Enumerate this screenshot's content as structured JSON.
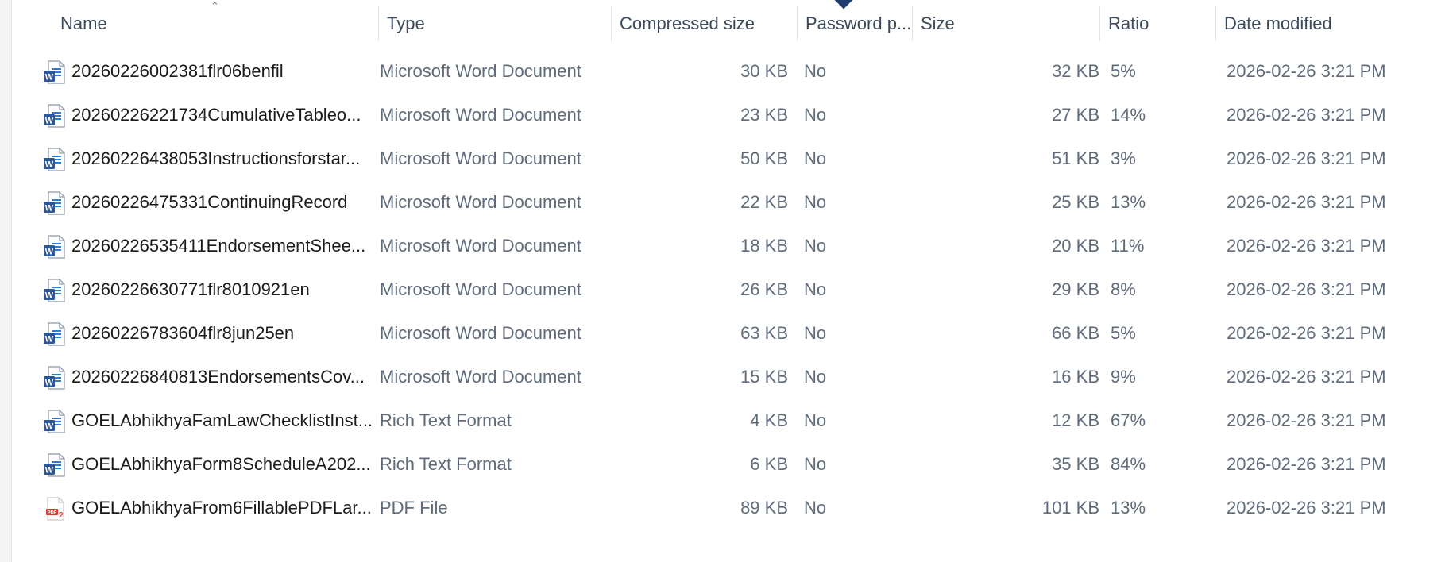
{
  "columns": {
    "name": "Name",
    "type": "Type",
    "compressed_size": "Compressed size",
    "password": "Password p...",
    "size": "Size",
    "ratio": "Ratio",
    "date_modified": "Date modified"
  },
  "icons": {
    "word": "word-document-icon",
    "pdf": "pdf-document-icon",
    "sort": "sort-caret-icon"
  },
  "colors": {
    "word_blue": "#2b579a",
    "pdf_red": "#d9382d",
    "header_text": "#3d4a5c",
    "cell_text": "#5f6b7a"
  },
  "files": [
    {
      "name": "20260226002381flr06benfil",
      "type": "Microsoft Word Document",
      "compressed": "30 KB",
      "password": "No",
      "size": "32 KB",
      "ratio": "5%",
      "date": "2026-02-26 3:21 PM",
      "icon": "word"
    },
    {
      "name": "20260226221734CumulativeTableo...",
      "type": "Microsoft Word Document",
      "compressed": "23 KB",
      "password": "No",
      "size": "27 KB",
      "ratio": "14%",
      "date": "2026-02-26 3:21 PM",
      "icon": "word"
    },
    {
      "name": "20260226438053Instructionsforstar...",
      "type": "Microsoft Word Document",
      "compressed": "50 KB",
      "password": "No",
      "size": "51 KB",
      "ratio": "3%",
      "date": "2026-02-26 3:21 PM",
      "icon": "word"
    },
    {
      "name": "20260226475331ContinuingRecord",
      "type": "Microsoft Word Document",
      "compressed": "22 KB",
      "password": "No",
      "size": "25 KB",
      "ratio": "13%",
      "date": "2026-02-26 3:21 PM",
      "icon": "word"
    },
    {
      "name": "20260226535411EndorsementShee...",
      "type": "Microsoft Word Document",
      "compressed": "18 KB",
      "password": "No",
      "size": "20 KB",
      "ratio": "11%",
      "date": "2026-02-26 3:21 PM",
      "icon": "word"
    },
    {
      "name": "20260226630771flr8010921en",
      "type": "Microsoft Word Document",
      "compressed": "26 KB",
      "password": "No",
      "size": "29 KB",
      "ratio": "8%",
      "date": "2026-02-26 3:21 PM",
      "icon": "word"
    },
    {
      "name": "20260226783604flr8jun25en",
      "type": "Microsoft Word Document",
      "compressed": "63 KB",
      "password": "No",
      "size": "66 KB",
      "ratio": "5%",
      "date": "2026-02-26 3:21 PM",
      "icon": "word"
    },
    {
      "name": "20260226840813EndorsementsCov...",
      "type": "Microsoft Word Document",
      "compressed": "15 KB",
      "password": "No",
      "size": "16 KB",
      "ratio": "9%",
      "date": "2026-02-26 3:21 PM",
      "icon": "word"
    },
    {
      "name": "GOELAbhikhyaFamLawChecklistInst...",
      "type": "Rich Text Format",
      "compressed": "4 KB",
      "password": "No",
      "size": "12 KB",
      "ratio": "67%",
      "date": "2026-02-26 3:21 PM",
      "icon": "word"
    },
    {
      "name": "GOELAbhikhyaForm8ScheduleA202...",
      "type": "Rich Text Format",
      "compressed": "6 KB",
      "password": "No",
      "size": "35 KB",
      "ratio": "84%",
      "date": "2026-02-26 3:21 PM",
      "icon": "word"
    },
    {
      "name": "GOELAbhikhyaFrom6FillablePDFLar...",
      "type": "PDF File",
      "compressed": "89 KB",
      "password": "No",
      "size": "101 KB",
      "ratio": "13%",
      "date": "2026-02-26 3:21 PM",
      "icon": "pdf"
    }
  ]
}
